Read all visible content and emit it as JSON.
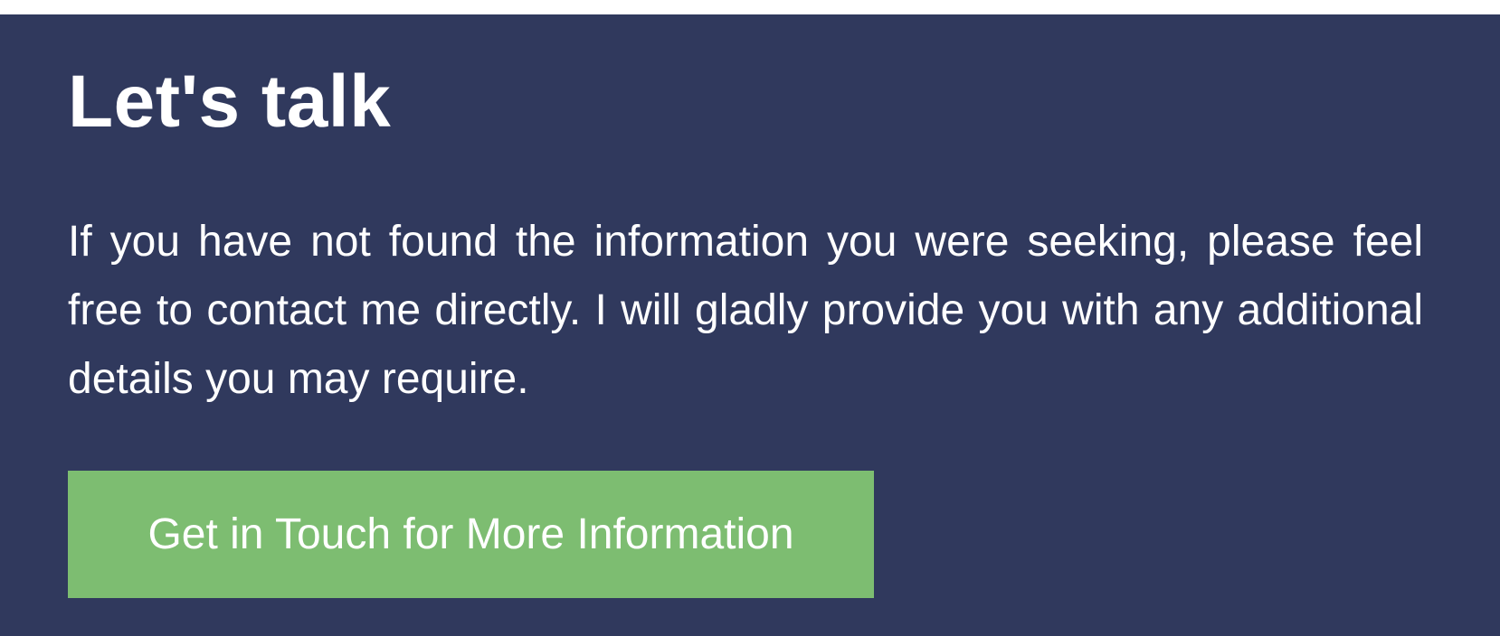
{
  "colors": {
    "section_background": "#30395d",
    "button_background": "#7dbd71",
    "text": "#ffffff"
  },
  "contact": {
    "heading": "Let's talk",
    "body": "If you have not found the information you were seeking, please feel free to contact me directly. I will gladly provide you with any additional details you may require.",
    "button_label": "Get in Touch for More Information"
  }
}
